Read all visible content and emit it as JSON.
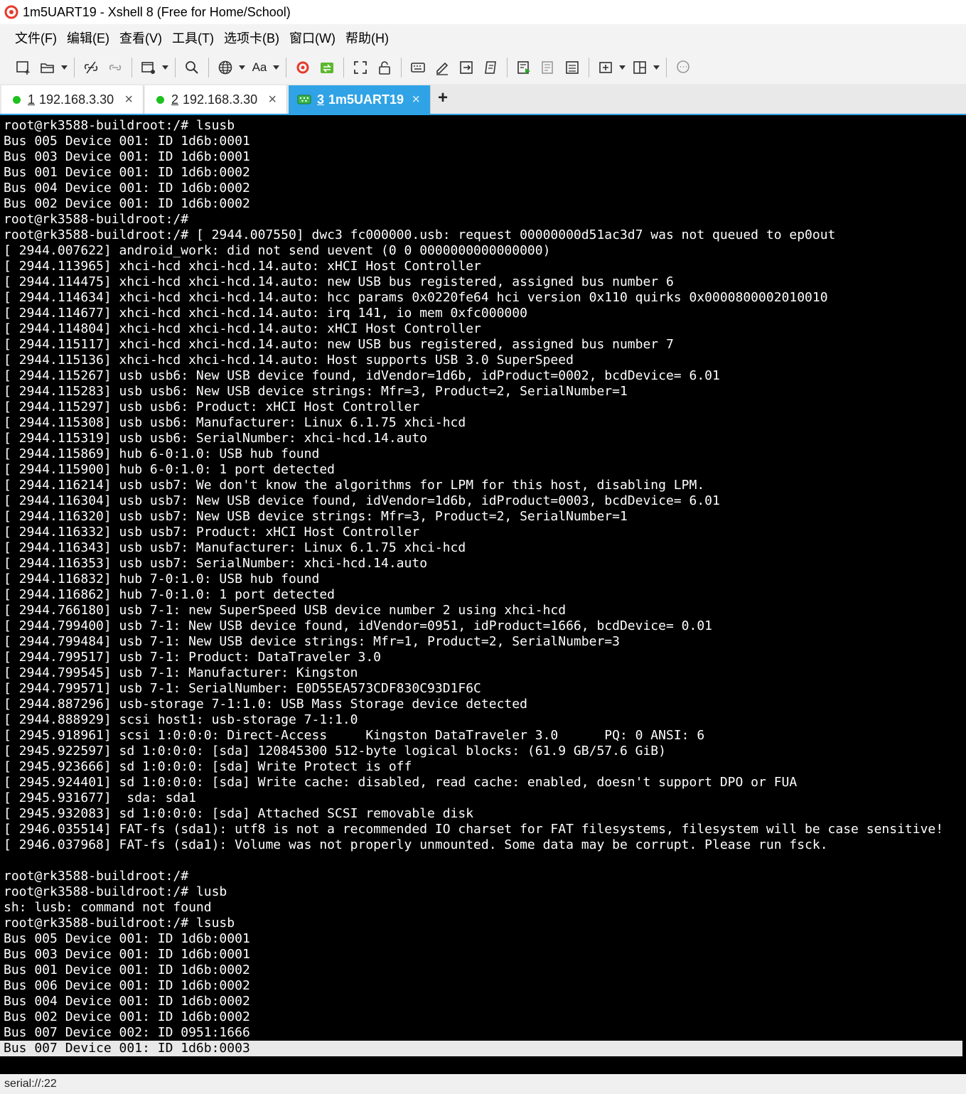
{
  "window": {
    "title": "1m5UART19 - Xshell 8 (Free for Home/School)"
  },
  "menu": [
    "文件(F)",
    "编辑(E)",
    "查看(V)",
    "工具(T)",
    "选项卡(B)",
    "窗口(W)",
    "帮助(H)"
  ],
  "toolbar": {
    "font_label": "Aa"
  },
  "tabs": [
    {
      "num": "1",
      "label": "192.168.3.30",
      "close": "×",
      "status_color": "#1ec11e"
    },
    {
      "num": "2",
      "label": "192.168.3.30",
      "close": "×",
      "status_color": "#1ec11e"
    },
    {
      "num": "3",
      "label": "1m5UART19",
      "close": "×",
      "active": true
    }
  ],
  "new_tab": "+",
  "terminal": {
    "lines": [
      "root@rk3588-buildroot:/# lsusb",
      "Bus 005 Device 001: ID 1d6b:0001",
      "Bus 003 Device 001: ID 1d6b:0001",
      "Bus 001 Device 001: ID 1d6b:0002",
      "Bus 004 Device 001: ID 1d6b:0002",
      "Bus 002 Device 001: ID 1d6b:0002",
      "root@rk3588-buildroot:/#",
      "root@rk3588-buildroot:/# [ 2944.007550] dwc3 fc000000.usb: request 00000000d51ac3d7 was not queued to ep0out",
      "[ 2944.007622] android_work: did not send uevent (0 0 0000000000000000)",
      "[ 2944.113965] xhci-hcd xhci-hcd.14.auto: xHCI Host Controller",
      "[ 2944.114475] xhci-hcd xhci-hcd.14.auto: new USB bus registered, assigned bus number 6",
      "[ 2944.114634] xhci-hcd xhci-hcd.14.auto: hcc params 0x0220fe64 hci version 0x110 quirks 0x0000800002010010",
      "[ 2944.114677] xhci-hcd xhci-hcd.14.auto: irq 141, io mem 0xfc000000",
      "[ 2944.114804] xhci-hcd xhci-hcd.14.auto: xHCI Host Controller",
      "[ 2944.115117] xhci-hcd xhci-hcd.14.auto: new USB bus registered, assigned bus number 7",
      "[ 2944.115136] xhci-hcd xhci-hcd.14.auto: Host supports USB 3.0 SuperSpeed",
      "[ 2944.115267] usb usb6: New USB device found, idVendor=1d6b, idProduct=0002, bcdDevice= 6.01",
      "[ 2944.115283] usb usb6: New USB device strings: Mfr=3, Product=2, SerialNumber=1",
      "[ 2944.115297] usb usb6: Product: xHCI Host Controller",
      "[ 2944.115308] usb usb6: Manufacturer: Linux 6.1.75 xhci-hcd",
      "[ 2944.115319] usb usb6: SerialNumber: xhci-hcd.14.auto",
      "[ 2944.115869] hub 6-0:1.0: USB hub found",
      "[ 2944.115900] hub 6-0:1.0: 1 port detected",
      "[ 2944.116214] usb usb7: We don't know the algorithms for LPM for this host, disabling LPM.",
      "[ 2944.116304] usb usb7: New USB device found, idVendor=1d6b, idProduct=0003, bcdDevice= 6.01",
      "[ 2944.116320] usb usb7: New USB device strings: Mfr=3, Product=2, SerialNumber=1",
      "[ 2944.116332] usb usb7: Product: xHCI Host Controller",
      "[ 2944.116343] usb usb7: Manufacturer: Linux 6.1.75 xhci-hcd",
      "[ 2944.116353] usb usb7: SerialNumber: xhci-hcd.14.auto",
      "[ 2944.116832] hub 7-0:1.0: USB hub found",
      "[ 2944.116862] hub 7-0:1.0: 1 port detected",
      "[ 2944.766180] usb 7-1: new SuperSpeed USB device number 2 using xhci-hcd",
      "[ 2944.799400] usb 7-1: New USB device found, idVendor=0951, idProduct=1666, bcdDevice= 0.01",
      "[ 2944.799484] usb 7-1: New USB device strings: Mfr=1, Product=2, SerialNumber=3",
      "[ 2944.799517] usb 7-1: Product: DataTraveler 3.0",
      "[ 2944.799545] usb 7-1: Manufacturer: Kingston",
      "[ 2944.799571] usb 7-1: SerialNumber: E0D55EA573CDF830C93D1F6C",
      "[ 2944.887296] usb-storage 7-1:1.0: USB Mass Storage device detected",
      "[ 2944.888929] scsi host1: usb-storage 7-1:1.0",
      "[ 2945.918961] scsi 1:0:0:0: Direct-Access     Kingston DataTraveler 3.0      PQ: 0 ANSI: 6",
      "[ 2945.922597] sd 1:0:0:0: [sda] 120845300 512-byte logical blocks: (61.9 GB/57.6 GiB)",
      "[ 2945.923666] sd 1:0:0:0: [sda] Write Protect is off",
      "[ 2945.924401] sd 1:0:0:0: [sda] Write cache: disabled, read cache: enabled, doesn't support DPO or FUA",
      "[ 2945.931677]  sda: sda1",
      "[ 2945.932083] sd 1:0:0:0: [sda] Attached SCSI removable disk",
      "[ 2946.035514] FAT-fs (sda1): utf8 is not a recommended IO charset for FAT filesystems, filesystem will be case sensitive!",
      "[ 2946.037968] FAT-fs (sda1): Volume was not properly unmounted. Some data may be corrupt. Please run fsck.",
      "",
      "root@rk3588-buildroot:/#",
      "root@rk3588-buildroot:/# lusb",
      "sh: lusb: command not found",
      "root@rk3588-buildroot:/# lsusb",
      "Bus 005 Device 001: ID 1d6b:0001",
      "Bus 003 Device 001: ID 1d6b:0001",
      "Bus 001 Device 001: ID 1d6b:0002",
      "Bus 006 Device 001: ID 1d6b:0002",
      "Bus 004 Device 001: ID 1d6b:0002",
      "Bus 002 Device 001: ID 1d6b:0002",
      "Bus 007 Device 002: ID 0951:1666",
      "Bus 007 Device 001: ID 1d6b:0003"
    ],
    "selected_lines": [
      59,
      60
    ]
  },
  "status": {
    "connection": "serial://:22"
  },
  "colors": {
    "accent": "#2fa3e6",
    "status_ok": "#1ec11e",
    "terminal_bg": "#000000",
    "terminal_fg": "#ffffff"
  }
}
